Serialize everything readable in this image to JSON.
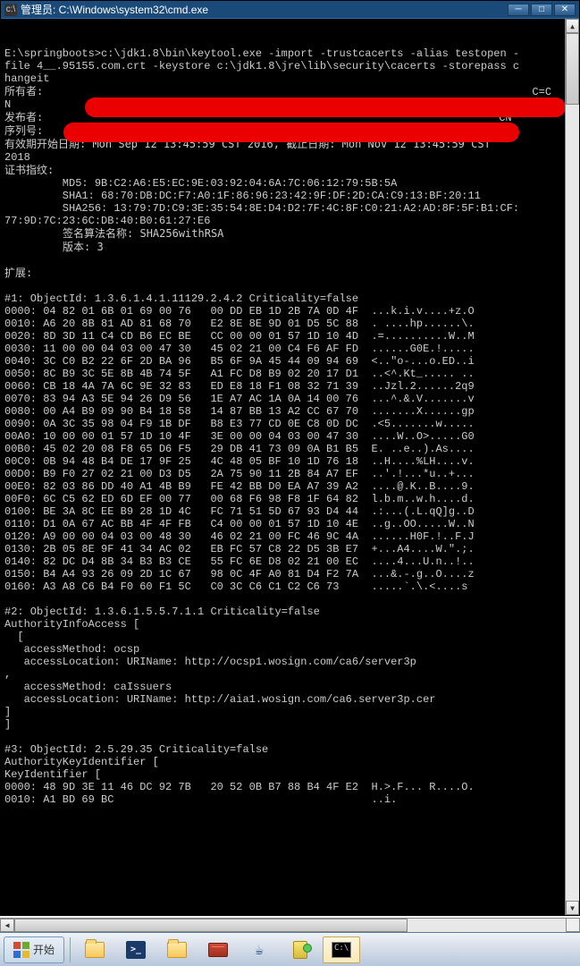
{
  "window": {
    "title": "管理员: C:\\Windows\\system32\\cmd.exe"
  },
  "console": {
    "blank1": "",
    "cmd1": "E:\\springboots>c:\\jdk1.8\\bin\\keytool.exe -import -trustcacerts -alias testopen -",
    "cmd2": "file 4__.95155.com.crt -keystore c:\\jdk1.8\\jre\\lib\\security\\cacerts -storepass c",
    "cmd3": "hangeit",
    "owner_label": "所有者:",
    "owner_tail": " C=C",
    "owner_n": "N",
    "issuer_label": "发布者:",
    "issuer_tail": "CN",
    "serial_label": "序列号:",
    "valid": "有效期开始日期: Mon Sep 12 13:45:59 CST 2016, 截止日期: Mon Nov 12 13:45:59 CST",
    "valid2": "2018",
    "fp_label": "证书指纹:",
    "md5": "         MD5: 9B:C2:A6:E5:EC:9E:03:92:04:6A:7C:06:12:79:5B:5A",
    "sha1": "         SHA1: 68:70:DB:DC:F7:A0:1F:86:96:23:42:9F:DF:2D:CA:C9:13:BF:20:11",
    "sha256a": "         SHA256: 13:79:7D:C9:3E:35:54:8E:D4:D2:7F:4C:8F:C0:21:A2:AD:8F:5F:B1:CF:",
    "sha256b": "77:9D:7C:23:6C:DB:40:B0:61:27:E6",
    "sigalg": "         签名算法名称: SHA256withRSA",
    "version": "         版本: 3",
    "blank2": "",
    "ext": "扩展:",
    "blank3": "",
    "ext1": "#1: ObjectId: 1.3.6.1.4.1.11129.2.4.2 Criticality=false",
    "hex": [
      "0000: 04 82 01 6B 01 69 00 76   00 DD EB 1D 2B 7A 0D 4F  ...k.i.v....+z.O",
      "0010: A6 20 8B 81 AD 81 68 70   E2 8E 8E 9D 01 D5 5C 88  . ....hp......\\.",
      "0020: 8D 3D 11 C4 CD B6 EC BE   CC 00 00 01 57 1D 10 4D  .=..........W..M",
      "0030: 11 00 00 04 03 00 47 30   45 02 21 00 C4 F6 AF FD  ......G0E.!.....",
      "0040: 3C C0 B2 22 6F 2D BA 96   B5 6F 9A 45 44 09 94 69  <..\"o-...o.ED..i",
      "0050: 8C B9 3C 5E 8B 4B 74 5F   A1 FC D8 B9 02 20 17 D1  ..<^.Kt_..... ..",
      "0060: CB 18 4A 7A 6C 9E 32 83   ED E8 18 F1 08 32 71 39  ..Jzl.2......2q9",
      "0070: 83 94 A3 5E 94 26 D9 56   1E A7 AC 1A 0A 14 00 76  ...^.&.V.......v",
      "0080: 00 A4 B9 09 90 B4 18 58   14 87 BB 13 A2 CC 67 70  .......X......gp",
      "0090: 0A 3C 35 98 04 F9 1B DF   B8 E3 77 CD 0E C8 0D DC  .<5.......w.....",
      "00A0: 10 00 00 01 57 1D 10 4F   3E 00 00 04 03 00 47 30  ....W..O>.....G0",
      "00B0: 45 02 20 08 F8 65 D6 F5   29 DB 41 73 09 0A B1 B5  E. ..e..).As....",
      "00C0: 0B 94 48 B4 DE 17 9F 25   4C 48 05 BF 10 1D 76 18  ..H....%LH....v.",
      "00D0: B9 F0 27 02 21 00 D3 D5   2A 75 90 11 2B 84 A7 EF  ..'.!...*u..+...",
      "00E0: 82 03 86 DD 40 A1 4B B9   FE 42 BB D0 EA A7 39 A2  ....@.K..B....9.",
      "00F0: 6C C5 62 ED 6D EF 00 77   00 68 F6 98 F8 1F 64 82  l.b.m..w.h....d.",
      "0100: BE 3A 8C EE B9 28 1D 4C   FC 71 51 5D 67 93 D4 44  .:...(.L.qQ]g..D",
      "0110: D1 0A 67 AC BB 4F 4F FB   C4 00 00 01 57 1D 10 4E  ..g..OO.....W..N",
      "0120: A9 00 00 04 03 00 48 30   46 02 21 00 FC 46 9C 4A  ......H0F.!..F.J",
      "0130: 2B 05 8E 9F 41 34 AC 02   EB FC 57 C8 22 D5 3B E7  +...A4....W.\".;.",
      "0140: 82 DC D4 8B 34 B3 B3 CE   55 FC 6E D8 02 21 00 EC  ....4...U.n..!..",
      "0150: B4 A4 93 26 09 2D 1C 67   98 0C 4F A0 81 D4 F2 7A  ...&.-.g..O....z",
      "0160: A3 A8 C6 B4 F0 60 F1 5C   C0 3C C6 C1 C2 C6 73     .....`.\\.<....s"
    ],
    "blank4": "",
    "ext2": "#2: ObjectId: 1.3.6.1.5.5.7.1.1 Criticality=false",
    "aia1": "AuthorityInfoAccess [",
    "aia2": "  [",
    "aia3": "   accessMethod: ocsp",
    "aia4": "   accessLocation: URIName: http://ocsp1.wosign.com/ca6/server3p",
    "aia5": ",",
    "aia6": "   accessMethod: caIssuers",
    "aia7": "   accessLocation: URIName: http://aia1.wosign.com/ca6.server3p.cer",
    "aia8": "]",
    "aia9": "]",
    "blank5": "",
    "ext3": "#3: ObjectId: 2.5.29.35 Criticality=false",
    "aki1": "AuthorityKeyIdentifier [",
    "aki2": "KeyIdentifier [",
    "aki3": "0000: 48 9D 3E 11 46 DC 92 7B   20 52 0B B7 88 B4 4F E2  H.>.F... R....O.",
    "aki4": "0010: A1 BD 69 BC                                        ..i."
  },
  "taskbar": {
    "start": "开始"
  }
}
